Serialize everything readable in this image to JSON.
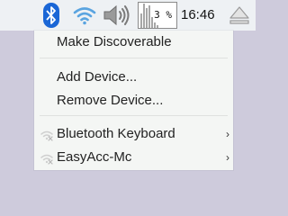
{
  "taskbar": {
    "cpu_label": "3 %",
    "clock": "16:46",
    "tray_icons": [
      "bluetooth-icon",
      "wifi-icon",
      "volume-icon",
      "cpu-monitor",
      "eject-icon"
    ]
  },
  "menu": {
    "items": [
      {
        "label": "Make Discoverable"
      },
      {
        "label": "Add Device..."
      },
      {
        "label": "Remove Device..."
      },
      {
        "label": "Bluetooth Keyboard",
        "icon": "device-disconnected-icon",
        "submenu": true
      },
      {
        "label": "EasyAcc-Mc",
        "icon": "device-disconnected-icon",
        "submenu": true
      }
    ],
    "submenu_arrow": "›"
  },
  "colors": {
    "desktop": "#cecbdc",
    "taskbar": "#eef1f4",
    "menu_bg": "#f4f6f4",
    "bluetooth_blue": "#1a66d6"
  }
}
